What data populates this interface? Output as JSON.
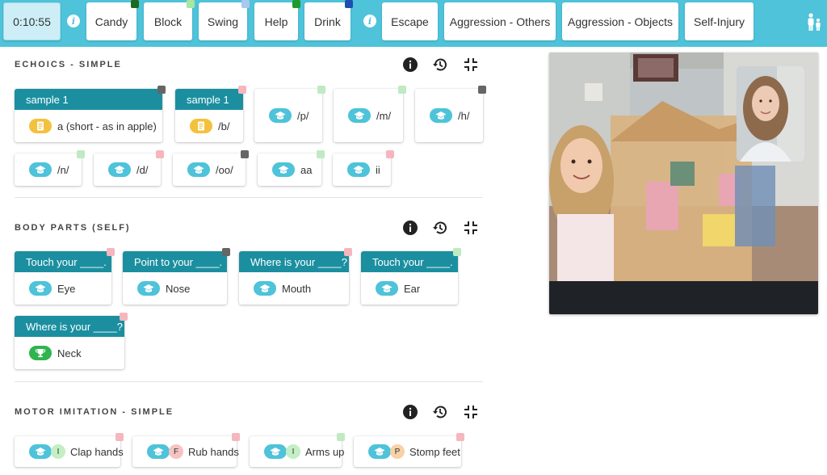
{
  "topbar": {
    "timer": "0:10:55",
    "buttons": [
      {
        "label": "Candy",
        "flag": "#1c6b1f"
      },
      {
        "label": "Block",
        "flag": "#a7e7a0"
      },
      {
        "label": "Swing",
        "flag": "#a9c8f0"
      },
      {
        "label": "Help",
        "flag": "#1e9a2f"
      },
      {
        "label": "Drink",
        "flag": "#1e4fb0"
      }
    ],
    "behaviors": [
      {
        "label": "Escape"
      },
      {
        "label": "Aggression - Others"
      },
      {
        "label": "Aggression - Objects"
      },
      {
        "label": "Self-Injury"
      }
    ]
  },
  "sections": [
    {
      "title": "ECHOICS - SIMPLE",
      "cards": [
        {
          "header": "sample 1",
          "label": "a (short - as in apple)",
          "icon": "document-icon",
          "flag": "#666666"
        },
        {
          "header": "sample 1",
          "label": "/b/",
          "icon": "document-icon",
          "flag": "#f6b6bd"
        },
        {
          "header": "",
          "label": "/p/",
          "icon": "graduation-cap-icon",
          "flag": "#bfeac2"
        },
        {
          "header": "",
          "label": "/m/",
          "icon": "graduation-cap-icon",
          "flag": "#bfeac2"
        },
        {
          "header": "",
          "label": "/h/",
          "icon": "graduation-cap-icon",
          "flag": "#666666"
        },
        {
          "header": "",
          "label": "/n/",
          "icon": "graduation-cap-icon",
          "flag": "#bfeac2"
        },
        {
          "header": "",
          "label": "/d/",
          "icon": "graduation-cap-icon",
          "flag": "#f6b6bd"
        },
        {
          "header": "",
          "label": "/oo/",
          "icon": "graduation-cap-icon",
          "flag": "#666666"
        },
        {
          "header": "",
          "label": "aa",
          "icon": "graduation-cap-icon",
          "flag": "#bfeac2"
        },
        {
          "header": "",
          "label": "ii",
          "icon": "graduation-cap-icon",
          "flag": "#f6b6bd"
        }
      ]
    },
    {
      "title": "BODY PARTS (SELF)",
      "cards": [
        {
          "header": "Touch your ____.",
          "label": "Eye",
          "icon": "graduation-cap-icon",
          "flag": "#f6b6bd"
        },
        {
          "header": "Point to your ____.",
          "label": "Nose",
          "icon": "graduation-cap-icon",
          "flag": "#666666"
        },
        {
          "header": "Where is your ____?",
          "label": "Mouth",
          "icon": "graduation-cap-icon",
          "flag": "#f6b6bd"
        },
        {
          "header": "Touch your ____.",
          "label": "Ear",
          "icon": "graduation-cap-icon",
          "flag": "#bfeac2"
        },
        {
          "header": "Where is your ____?",
          "label": "Neck",
          "icon": "trophy-icon",
          "flag": "#f6b6bd"
        }
      ]
    },
    {
      "title": "MOTOR IMITATION - SIMPLE",
      "cards": [
        {
          "header": "",
          "label": "Clap hands",
          "icon": "graduation-cap-icon",
          "prompt": "I",
          "prompt_color": "#c4eec4",
          "flag": "#f6b6bd"
        },
        {
          "header": "",
          "label": "Rub hands",
          "icon": "graduation-cap-icon",
          "prompt": "F",
          "prompt_color": "#f6c3c3",
          "flag": "#f6b6bd"
        },
        {
          "header": "",
          "label": "Arms up",
          "icon": "graduation-cap-icon",
          "prompt": "I",
          "prompt_color": "#c4eec4",
          "flag": "#bfeac2"
        },
        {
          "header": "",
          "label": "Stomp feet",
          "icon": "graduation-cap-icon",
          "prompt": "P",
          "prompt_color": "#f7d2a6",
          "flag": "#f6b6bd"
        }
      ]
    }
  ],
  "video": {
    "controls": [
      "more-icon",
      "microphone-icon",
      "camera-icon",
      "hang-up-icon"
    ]
  },
  "colors": {
    "topbar": "#4ec3d9",
    "card_header": "#1b8fa0",
    "accent": "#4ec3d9"
  }
}
